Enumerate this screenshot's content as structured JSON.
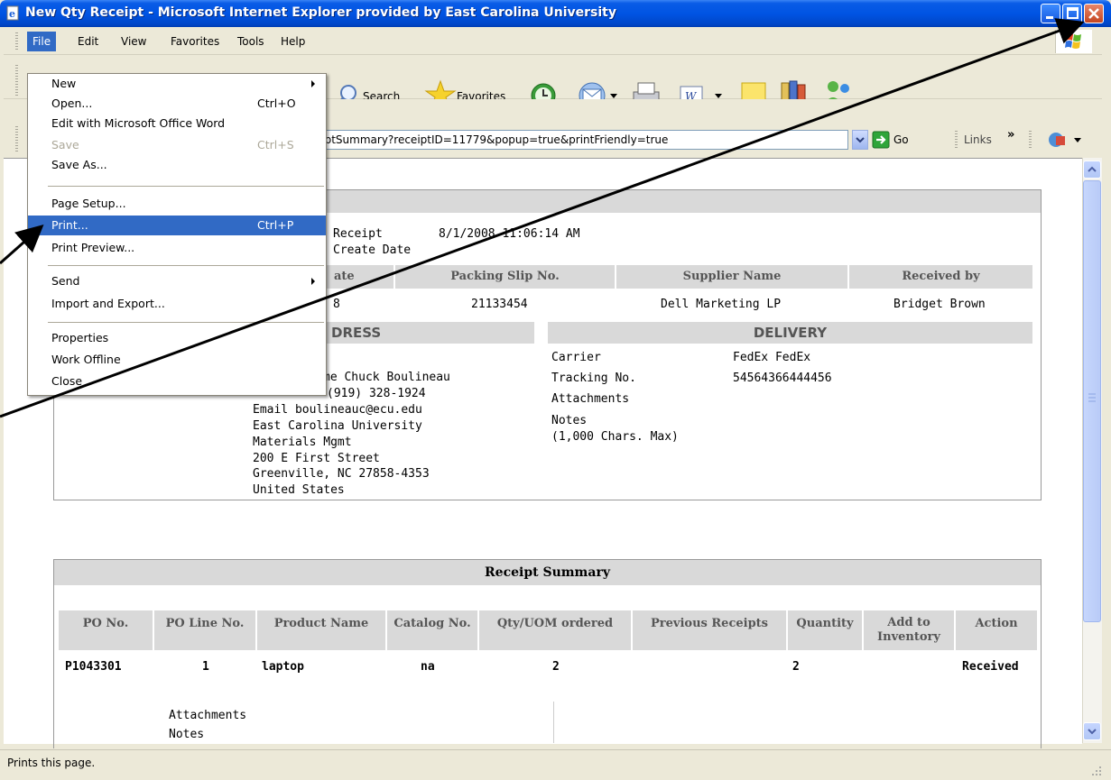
{
  "window": {
    "title": "New Qty Receipt - Microsoft Internet Explorer provided by East Carolina University"
  },
  "menubar": {
    "items": [
      "File",
      "Edit",
      "View",
      "Favorites",
      "Tools",
      "Help"
    ]
  },
  "toolbar": {
    "search_label": "Search",
    "favorites_label": "Favorites"
  },
  "address": {
    "url_visible": "s/Router/ReceiptSummary?receiptID=11779&popup=true&printFriendly=true",
    "go_label": "Go",
    "links_label": "Links"
  },
  "file_menu": {
    "items": [
      {
        "label": "New",
        "shortcut": "",
        "submenu": true,
        "disabled": false
      },
      {
        "label": "Open...",
        "shortcut": "Ctrl+O",
        "submenu": false,
        "disabled": false
      },
      {
        "label": "Edit with Microsoft Office Word",
        "shortcut": "",
        "submenu": false,
        "disabled": false
      },
      {
        "label": "Save",
        "shortcut": "Ctrl+S",
        "submenu": false,
        "disabled": true
      },
      {
        "label": "Save As...",
        "shortcut": "",
        "submenu": false,
        "disabled": false
      },
      {
        "label": "Page Setup...",
        "shortcut": "",
        "submenu": false,
        "disabled": false
      },
      {
        "label": "Print...",
        "shortcut": "Ctrl+P",
        "submenu": false,
        "disabled": false,
        "highlighted": true
      },
      {
        "label": "Print Preview...",
        "shortcut": "",
        "submenu": false,
        "disabled": false
      },
      {
        "label": "Send",
        "shortcut": "",
        "submenu": true,
        "disabled": false
      },
      {
        "label": "Import and Export...",
        "shortcut": "",
        "submenu": false,
        "disabled": false
      },
      {
        "label": "Properties",
        "shortcut": "",
        "submenu": false,
        "disabled": false
      },
      {
        "label": "Work Offline",
        "shortcut": "",
        "submenu": false,
        "disabled": false
      },
      {
        "label": "Close",
        "shortcut": "",
        "submenu": false,
        "disabled": false
      }
    ]
  },
  "receipt_info": {
    "receipt_label_1": "Receipt",
    "receipt_label_2": "Create Date",
    "create_date": "8/1/2008 11:06:14 AM"
  },
  "receipt_table": {
    "headers": [
      "ate",
      "Packing Slip No.",
      "Supplier Name",
      "Received by"
    ],
    "row": [
      "8",
      "21133454",
      "Dell Marketing LP",
      "Bridget Brown"
    ]
  },
  "address_section": {
    "header": "DRESS",
    "lines": [
      "me Chuck Boulineau",
      "(919) 328-1924",
      "Email boulineauc@ecu.edu",
      "East Carolina University",
      "Materials Mgmt",
      "200 E First Street",
      "Greenville, NC 27858-4353",
      "United States"
    ]
  },
  "delivery": {
    "header": "DELIVERY",
    "carrier_label": "Carrier",
    "carrier_value": "FedEx FedEx",
    "tracking_label": "Tracking No.",
    "tracking_value": "54564366444456",
    "attachments_label": "Attachments",
    "notes_label": "Notes",
    "notes_hint": "(1,000 Chars. Max)"
  },
  "summary": {
    "title": "Receipt Summary",
    "headers": [
      "PO No.",
      "PO Line No.",
      "Product Name",
      "Catalog No.",
      "Qty/UOM ordered",
      "Previous Receipts",
      "Quantity",
      "Add to Inventory",
      "Action"
    ],
    "row": [
      "P1043301",
      "1",
      "laptop",
      "na",
      "2",
      "",
      "2",
      "",
      "Received"
    ],
    "attachments_label": "Attachments",
    "notes_label": "Notes"
  },
  "status": {
    "text": "Prints this page."
  },
  "colors": {
    "titlebar": "#0054e3",
    "menu_highlight": "#316AC5",
    "chrome": "#ECE9D8",
    "header_gray": "#d9d9d9"
  }
}
